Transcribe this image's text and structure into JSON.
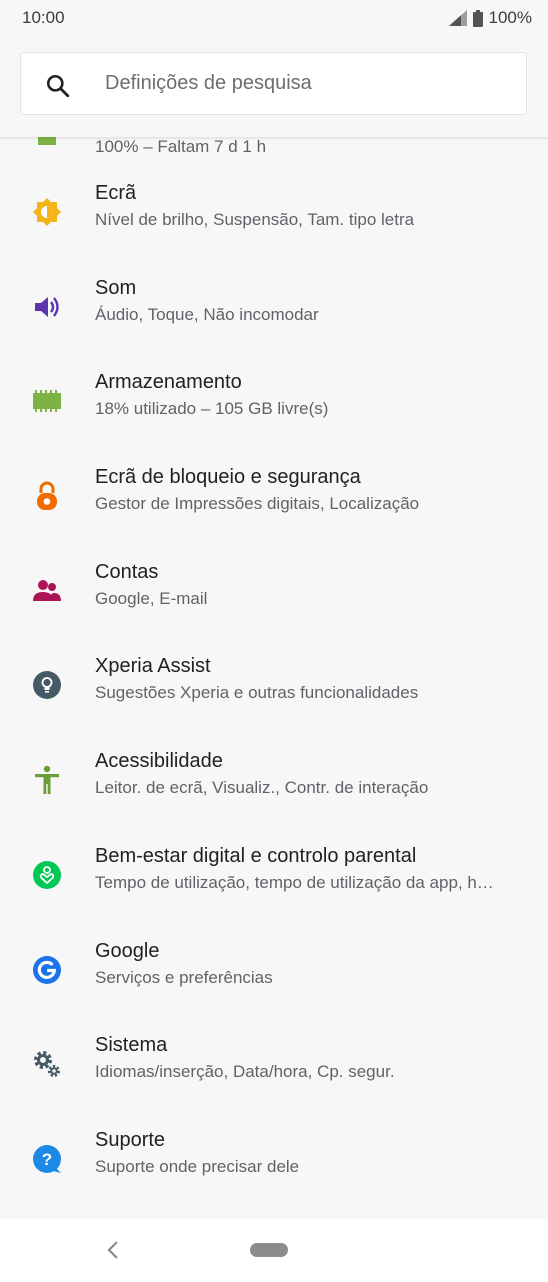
{
  "status_bar": {
    "time": "10:00",
    "battery_percent": "100%"
  },
  "search": {
    "placeholder": "Definições de pesquisa"
  },
  "partial_item": {
    "subtitle": "100% – Faltam 7 d 1 h"
  },
  "items": [
    {
      "title": "Ecrã",
      "subtitle": "Nível de brilho, Suspensão, Tam. tipo letra",
      "icon": "display-icon",
      "color": "#f5b31a"
    },
    {
      "title": "Som",
      "subtitle": "Áudio, Toque, Não incomodar",
      "icon": "speaker-icon",
      "color": "#5e35b1"
    },
    {
      "title": "Armazenamento",
      "subtitle": "18% utilizado – 105 GB livre(s)",
      "icon": "storage-icon",
      "color": "#7cb342"
    },
    {
      "title": "Ecrã de bloqueio e segurança",
      "subtitle": "Gestor de Impressões digitais, Localização",
      "icon": "lock-icon",
      "color": "#ef6c00"
    },
    {
      "title": "Contas",
      "subtitle": "Google, E-mail",
      "icon": "accounts-icon",
      "color": "#ad1457"
    },
    {
      "title": "Xperia Assist",
      "subtitle": "Sugestões Xperia e outras funcionalidades",
      "icon": "lightbulb-icon",
      "color": "#455a64"
    },
    {
      "title": "Acessibilidade",
      "subtitle": "Leitor. de ecrã, Visualiz., Contr. de interação",
      "icon": "accessibility-icon",
      "color": "#689f38"
    },
    {
      "title": "Bem-estar digital e controlo parental",
      "subtitle": "Tempo de utilização, tempo de utilização da app, h…",
      "icon": "wellbeing-icon",
      "color": "#00c853"
    },
    {
      "title": "Google",
      "subtitle": "Serviços e preferências",
      "icon": "google-icon",
      "color": "#1a73e8"
    },
    {
      "title": "Sistema",
      "subtitle": "Idiomas/inserção, Data/hora, Cp. segur.",
      "icon": "gears-icon",
      "color": "#455a64"
    },
    {
      "title": "Suporte",
      "subtitle": "Suporte onde precisar dele",
      "icon": "help-icon",
      "color": "#1e88e5"
    }
  ]
}
